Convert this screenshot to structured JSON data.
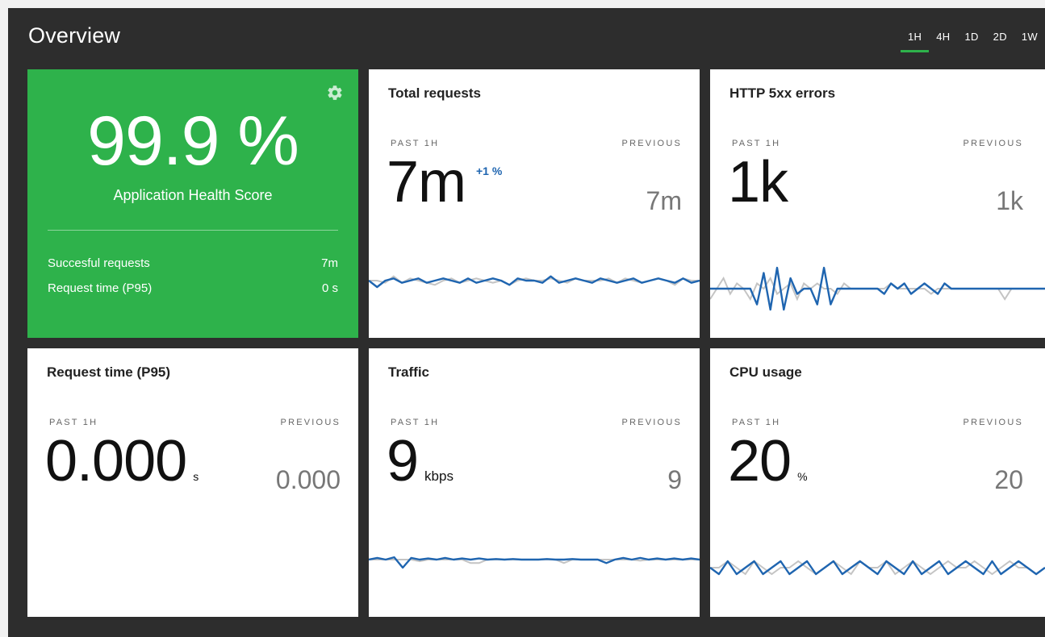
{
  "header": {
    "title": "Overview",
    "ranges": [
      "1H",
      "4H",
      "1D",
      "2D",
      "1W"
    ],
    "active_range": "1H"
  },
  "colors": {
    "background": "#2d2d2d",
    "health": "#2eb24b",
    "series_current": "#1f65b0",
    "series_previous": "#c4c4c4"
  },
  "health": {
    "score": "99.9 %",
    "label": "Application Health Score",
    "icon": "gear-icon",
    "stats": [
      {
        "label": "Succesful requests",
        "value": "7m"
      },
      {
        "label": "Request time (P95)",
        "value": "0 s"
      }
    ]
  },
  "cards": {
    "total_requests": {
      "title": "Total requests",
      "past_label": "PAST 1H",
      "prev_label": "PREVIOUS",
      "value": "7m",
      "delta": "+1 %",
      "previous": "7m"
    },
    "http_5xx": {
      "title": "HTTP 5xx errors",
      "past_label": "PAST 1H",
      "prev_label": "PREVIOUS",
      "value": "1k",
      "previous": "1k"
    },
    "request_time": {
      "title": "Request time (P95)",
      "past_label": "PAST 1H",
      "prev_label": "PREVIOUS",
      "value": "0.000",
      "unit": "s",
      "previous": "0.000"
    },
    "traffic": {
      "title": "Traffic",
      "past_label": "PAST 1H",
      "prev_label": "PREVIOUS",
      "value": "9",
      "unit": "kbps",
      "previous": "9"
    },
    "cpu": {
      "title": "CPU usage",
      "past_label": "PAST 1H",
      "prev_label": "PREVIOUS",
      "value": "20",
      "unit": "%",
      "previous": "20"
    }
  },
  "sparklines": {
    "total_requests": {
      "current": [
        0,
        -3,
        0,
        1,
        -1,
        0,
        1,
        -1,
        0,
        1,
        0,
        -1,
        1,
        -1,
        0,
        1,
        0,
        -2,
        1,
        0,
        0,
        -1,
        2,
        -1,
        0,
        1,
        0,
        -1,
        1,
        0,
        -1,
        0,
        1,
        -1,
        0,
        1,
        0,
        -1,
        1,
        -1,
        0
      ],
      "previous": [
        0,
        0,
        -1,
        2,
        -1,
        1,
        0,
        -1,
        -2,
        0,
        1,
        -1,
        0,
        1,
        0,
        -1,
        0,
        -2,
        0,
        1,
        0,
        0,
        1,
        0,
        -1,
        1,
        0,
        0,
        0,
        1,
        -1,
        1,
        0,
        -1,
        0,
        1,
        0,
        -2,
        1,
        0,
        0
      ]
    },
    "http_5xx": {
      "current": [
        0,
        0,
        0,
        0,
        0,
        0,
        0,
        -3,
        3,
        -4,
        4,
        -4,
        2,
        -1,
        0,
        0,
        -3,
        4,
        -3,
        0,
        0,
        0,
        0,
        0,
        0,
        0,
        -1,
        1,
        0,
        1,
        -1,
        0,
        1,
        0,
        -1,
        1,
        0,
        0,
        0,
        0,
        0,
        0,
        0,
        0,
        0,
        0,
        0,
        0,
        0,
        0,
        0
      ],
      "previous": [
        -2,
        0,
        2,
        -1,
        1,
        0,
        -2,
        1,
        0,
        2,
        -1,
        0,
        1,
        -2,
        1,
        0,
        1,
        0,
        0,
        -1,
        1,
        0,
        0,
        0,
        0,
        0,
        0,
        1,
        0,
        0,
        0,
        0,
        0,
        -1,
        0,
        0,
        0,
        0,
        0,
        0,
        0,
        0,
        0,
        0,
        -2,
        0,
        0,
        0,
        0,
        0,
        0
      ]
    },
    "traffic": {
      "current": [
        0,
        0.3,
        0,
        0.4,
        -1.4,
        0.3,
        0,
        0.2,
        0,
        0.3,
        0,
        0.2,
        0,
        0.2,
        0,
        0.1,
        0,
        0.1,
        0,
        0,
        0,
        0.1,
        0,
        0,
        0.1,
        0,
        0,
        0,
        -0.6,
        0,
        0.3,
        0,
        0.3,
        0,
        0.2,
        0,
        0.2,
        0,
        0.2,
        0
      ],
      "previous": [
        0,
        0,
        0,
        0,
        0,
        0,
        -0.3,
        0,
        0,
        0,
        0,
        0,
        -0.6,
        -0.6,
        0,
        0,
        0,
        0,
        0,
        0,
        0,
        0,
        0,
        -0.6,
        0,
        0,
        0,
        0,
        0,
        0,
        0,
        0,
        -0.2,
        0,
        0,
        0,
        0,
        0,
        0,
        0
      ]
    },
    "cpu": {
      "current": [
        0,
        -1,
        1,
        -1,
        0,
        1,
        -1,
        0,
        1,
        -1,
        0,
        1,
        -1,
        0,
        1,
        -1,
        0,
        1,
        0,
        -1,
        1,
        0,
        -1,
        1,
        -1,
        0,
        1,
        -1,
        0,
        1,
        0,
        -1,
        1,
        -1,
        0,
        1,
        0,
        -1,
        0
      ],
      "previous": [
        0,
        0,
        1,
        0,
        -1,
        1,
        0,
        -1,
        0,
        0,
        1,
        0,
        -1,
        0,
        1,
        0,
        -1,
        1,
        0,
        0,
        1,
        -1,
        0,
        1,
        0,
        -1,
        0,
        1,
        0,
        0,
        1,
        0,
        -1,
        0,
        1,
        0,
        0,
        -1,
        0
      ]
    }
  }
}
